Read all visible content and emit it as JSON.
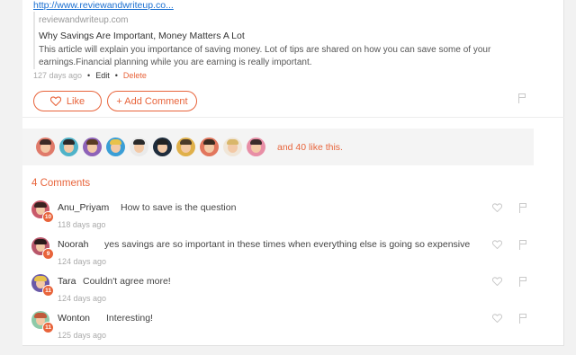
{
  "post": {
    "link_text": "http://www.reviewandwriteup.co...",
    "preview": {
      "domain": "reviewandwriteup.com",
      "title": "Why Savings Are Important, Money Matters A Lot",
      "description": "This article will explain you importance of saving money. Lot of tips are shared on how you can save some of your earnings.Financial planning while you are earning is really important."
    },
    "meta": {
      "time": "127 days ago",
      "dot": "•",
      "edit_label": "Edit",
      "delete_label": "Delete"
    },
    "like_label": "Like",
    "add_comment_label": "+ Add Comment"
  },
  "likes": {
    "text": "and 40 like this.",
    "avatars": [
      {
        "bg": "#e07a6a",
        "hair": "#3b2a25"
      },
      {
        "bg": "#4fb3c9",
        "hair": "#2a2a2a"
      },
      {
        "bg": "#8e62b8",
        "hair": "#5a3a22"
      },
      {
        "bg": "#3a9ed6",
        "hair": "#e8c24a"
      },
      {
        "bg": "#eaeaea",
        "hair": "#2a2a2a"
      },
      {
        "bg": "#1f2d3d",
        "hair": "#222222"
      },
      {
        "bg": "#e0b04a",
        "hair": "#4a3a2a"
      },
      {
        "bg": "#e2765d",
        "hair": "#3a2a20"
      },
      {
        "bg": "#f0e6d8",
        "hair": "#d9b76a"
      },
      {
        "bg": "#e88ea6",
        "hair": "#3a2a2a"
      }
    ]
  },
  "comments": {
    "title": "4 Comments",
    "items": [
      {
        "name": "Anu_Priyam",
        "text": "How to save is the question",
        "time": "118 days ago",
        "badge": "10",
        "bg": "#c95a6a",
        "hair": "#3a2220"
      },
      {
        "name": "Noorah",
        "text": "yes savings are so important in these times when everything else is going so expensive",
        "time": "124 days ago",
        "badge": "9",
        "bg": "#b8566a",
        "hair": "#2a1a1a"
      },
      {
        "name": "Tara",
        "text": "Couldn't agree more!",
        "time": "124 days ago",
        "badge": "11",
        "bg": "#6b5aa8",
        "hair": "#e8c24a"
      },
      {
        "name": "Wonton",
        "text": "Interesting!",
        "time": "125 days ago",
        "badge": "11",
        "bg": "#8ec9a8",
        "hair": "#c05a3a"
      }
    ]
  },
  "colors": {
    "accent": "#e8643b",
    "link": "#1a6fd1"
  },
  "icons": {
    "like": "heart-outline-icon",
    "flag": "flag-icon"
  }
}
